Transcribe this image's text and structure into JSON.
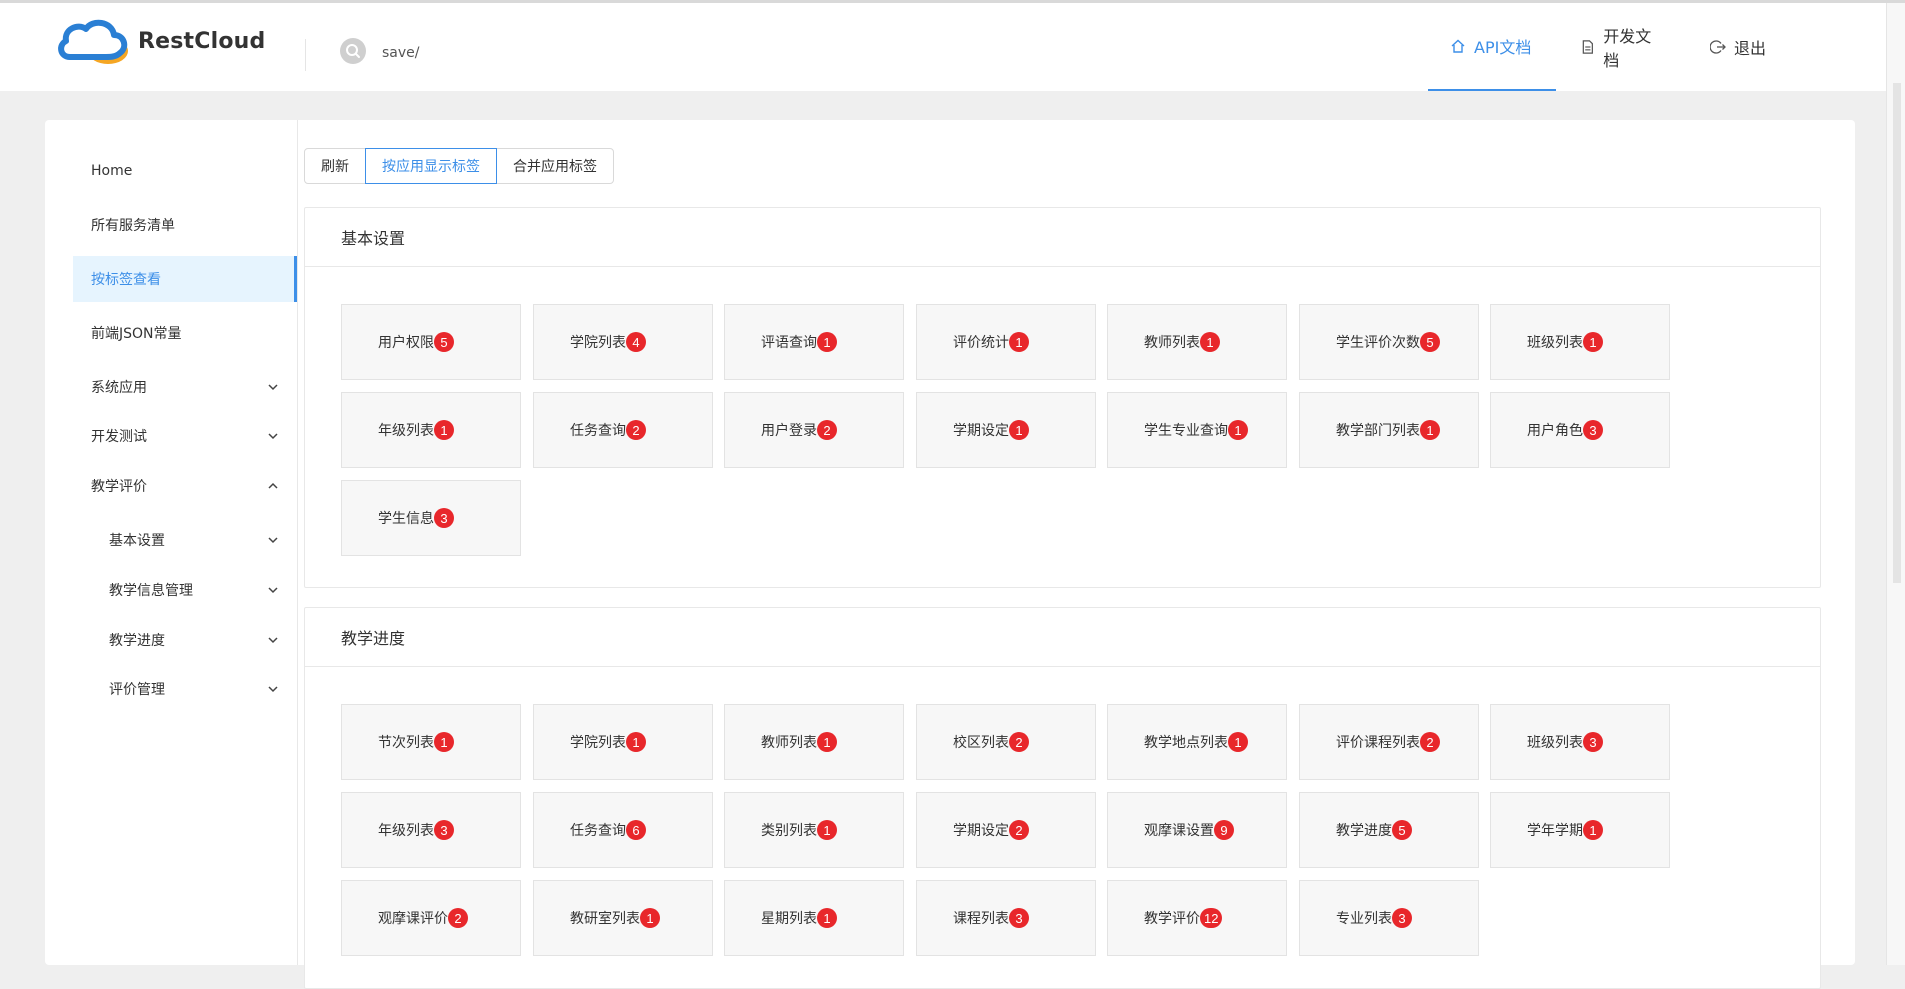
{
  "brand": {
    "name": "RestCloud"
  },
  "search": {
    "value": "save/"
  },
  "nav": [
    {
      "label": "API文档",
      "icon": "home-icon",
      "active": true
    },
    {
      "label": "开发文档",
      "icon": "document-icon",
      "active": false
    },
    {
      "label": "退出",
      "icon": "logout-icon",
      "active": false
    }
  ],
  "sidebar": {
    "items": [
      {
        "label": "Home",
        "sub": false,
        "active": false,
        "chevron": ""
      },
      {
        "label": "所有服务清单",
        "sub": false,
        "active": false,
        "chevron": ""
      },
      {
        "label": "按标签查看",
        "sub": false,
        "active": true,
        "chevron": ""
      },
      {
        "label": "前端JSON常量",
        "sub": false,
        "active": false,
        "chevron": ""
      },
      {
        "label": "系统应用",
        "sub": false,
        "active": false,
        "chevron": "down"
      },
      {
        "label": "开发测试",
        "sub": false,
        "active": false,
        "chevron": "down"
      },
      {
        "label": "教学评价",
        "sub": false,
        "active": false,
        "chevron": "up"
      },
      {
        "label": "基本设置",
        "sub": true,
        "active": false,
        "chevron": "down"
      },
      {
        "label": "教学信息管理",
        "sub": true,
        "active": false,
        "chevron": "down"
      },
      {
        "label": "教学进度",
        "sub": true,
        "active": false,
        "chevron": "down"
      },
      {
        "label": "评价管理",
        "sub": true,
        "active": false,
        "chevron": "down"
      }
    ]
  },
  "toolbar": {
    "refresh": "刷新",
    "by_app": "按应用显示标签",
    "merge": "合并应用标签"
  },
  "sections": [
    {
      "title": "基本设置",
      "tags": [
        {
          "label": "用户权限",
          "count": "5"
        },
        {
          "label": "学院列表",
          "count": "4"
        },
        {
          "label": "评语查询",
          "count": "1"
        },
        {
          "label": "评价统计",
          "count": "1"
        },
        {
          "label": "教师列表",
          "count": "1"
        },
        {
          "label": "学生评价次数",
          "count": "5"
        },
        {
          "label": "班级列表",
          "count": "1"
        },
        {
          "label": "年级列表",
          "count": "1"
        },
        {
          "label": "任务查询",
          "count": "2"
        },
        {
          "label": "用户登录",
          "count": "2"
        },
        {
          "label": "学期设定",
          "count": "1"
        },
        {
          "label": "学生专业查询",
          "count": "1"
        },
        {
          "label": "教学部门列表",
          "count": "1"
        },
        {
          "label": "用户角色",
          "count": "3"
        },
        {
          "label": "学生信息",
          "count": "3"
        }
      ]
    },
    {
      "title": "教学进度",
      "tags": [
        {
          "label": "节次列表",
          "count": "1"
        },
        {
          "label": "学院列表",
          "count": "1"
        },
        {
          "label": "教师列表",
          "count": "1"
        },
        {
          "label": "校区列表",
          "count": "2"
        },
        {
          "label": "教学地点列表",
          "count": "1"
        },
        {
          "label": "评价课程列表",
          "count": "2"
        },
        {
          "label": "班级列表",
          "count": "3"
        },
        {
          "label": "年级列表",
          "count": "3"
        },
        {
          "label": "任务查询",
          "count": "6"
        },
        {
          "label": "类别列表",
          "count": "1"
        },
        {
          "label": "学期设定",
          "count": "2"
        },
        {
          "label": "观摩课设置",
          "count": "9"
        },
        {
          "label": "教学进度",
          "count": "5"
        },
        {
          "label": "学年学期",
          "count": "1"
        },
        {
          "label": "观摩课评价",
          "count": "2"
        },
        {
          "label": "教研室列表",
          "count": "1"
        },
        {
          "label": "星期列表",
          "count": "1"
        },
        {
          "label": "课程列表",
          "count": "3"
        },
        {
          "label": "教学评价",
          "count": "12"
        },
        {
          "label": "专业列表",
          "count": "3"
        }
      ]
    }
  ],
  "colors": {
    "accent": "#3d8fe8",
    "badge": "#e8272b",
    "logo_blue": "#2a7fd4",
    "logo_orange": "#f5a623"
  }
}
